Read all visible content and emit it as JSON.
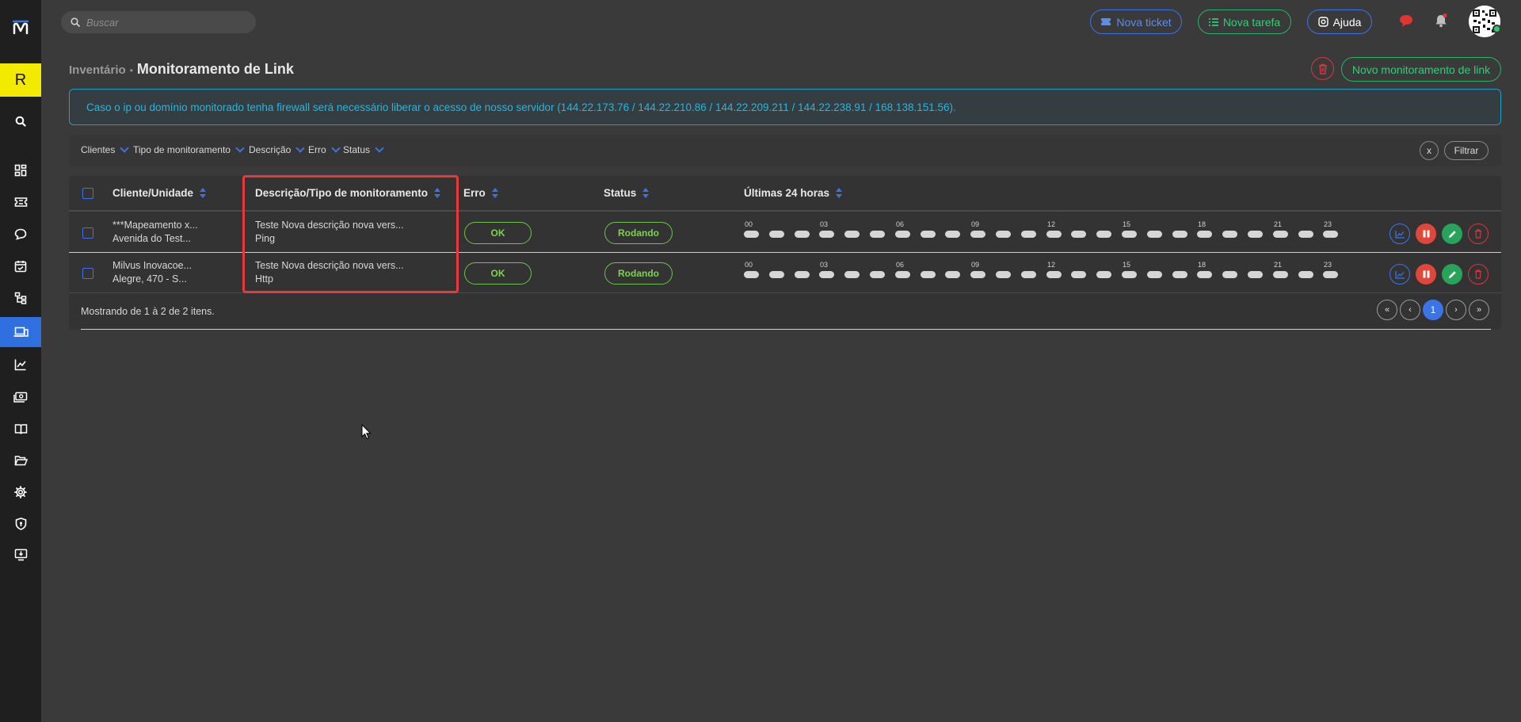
{
  "sidebar": {
    "brand_letter": "R",
    "icons": [
      "search-icon",
      "dashboard-icon",
      "ticket-icon",
      "chat-icon",
      "calendar-icon",
      "hierarchy-icon",
      "devices-icon",
      "chart-icon",
      "money-icon",
      "book-icon",
      "folder-icon",
      "gear-icon",
      "shield-icon",
      "download-monitor-icon"
    ],
    "active": "devices-icon"
  },
  "topbar": {
    "search_placeholder": "Buscar",
    "nova_ticket": "Nova ticket",
    "nova_tarefa": "Nova tarefa",
    "ajuda": "Ajuda"
  },
  "header": {
    "parent": "Inventário",
    "separator": "•",
    "title": "Monitoramento de Link",
    "new_button": "Novo monitoramento de link"
  },
  "alert": {
    "text": "Caso o ip ou domínio monitorado tenha firewall será necessário liberar o acesso de nosso servidor (144.22.173.76 / 144.22.210.86 / 144.22.209.211 / 144.22.238.91 / 168.138.151.56)."
  },
  "filters": {
    "items": [
      "Clientes",
      "Tipo de monitoramento",
      "Descrição",
      "Erro",
      "Status"
    ],
    "clear": "x",
    "apply": "Filtrar"
  },
  "table": {
    "headers": [
      "Cliente/Unidade",
      "Descrição/Tipo de monitoramento",
      "Erro",
      "Status",
      "Últimas 24 horas"
    ],
    "hour_labels": [
      "00",
      "03",
      "06",
      "09",
      "12",
      "15",
      "18",
      "21",
      "23"
    ],
    "rows": [
      {
        "cliente": "***Mapeamento x...",
        "unidade": "Avenida do Test...",
        "descricao": "Teste Nova descrição nova vers...",
        "tipo": "Ping",
        "erro": "OK",
        "status": "Rodando"
      },
      {
        "cliente": "Milvus Inovacoe...",
        "unidade": "Alegre, 470 - S...",
        "descricao": "Teste Nova descrição nova vers...",
        "tipo": "Http",
        "erro": "OK",
        "status": "Rodando"
      }
    ],
    "footer": "Mostrando de 1 à 2 de 2 itens.",
    "pagination": {
      "first": "«",
      "prev": "‹",
      "current": "1",
      "next": "›",
      "last": "»"
    }
  },
  "colors": {
    "accent_blue": "#3b74e6",
    "accent_green": "#27b36a",
    "alert_cyan": "#17a2c6",
    "danger_red": "#e8383e",
    "brand_yellow": "#f2ea00"
  }
}
